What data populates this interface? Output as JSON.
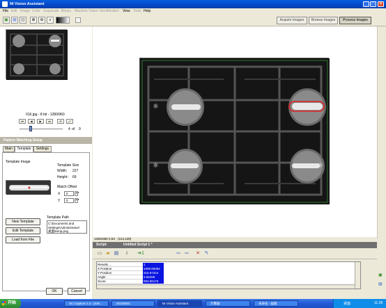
{
  "window": {
    "title": "NI Vision Assistant",
    "min": "_",
    "max": "□",
    "close": "×"
  },
  "menu": [
    {
      "label": "File",
      "enabled": true
    },
    {
      "label": "Edit",
      "enabled": false
    },
    {
      "label": "Image",
      "enabled": false
    },
    {
      "label": "Color",
      "enabled": false
    },
    {
      "label": "Grayscale",
      "enabled": false
    },
    {
      "label": "Binary",
      "enabled": false
    },
    {
      "label": "Machine Vision",
      "enabled": false
    },
    {
      "label": "Identification",
      "enabled": false
    },
    {
      "label": "View",
      "enabled": true
    },
    {
      "label": "Tools",
      "enabled": false
    },
    {
      "label": "Help",
      "enabled": true
    }
  ],
  "modes": [
    "Acquire Images",
    "Browse Images",
    "Process Images"
  ],
  "browser": {
    "file_info": "016.jpg - 8 bit - 1280/960",
    "position": "4",
    "of_label": "of",
    "total": "9",
    "nav": [
      "⏮",
      "◀",
      "▶",
      "⏭"
    ]
  },
  "setup": {
    "title": "Pattern Matching Setup",
    "tabs": [
      "Main",
      "Template",
      "Settings"
    ],
    "template_image_label": "Template Image",
    "template_size_label": "Template Size",
    "width_label": "Width:",
    "width": "227",
    "height_label": "Height:",
    "height": "69",
    "match_offset_label": "Match Offset",
    "x_label": "X",
    "x": "0",
    "y_label": "Y",
    "y": "0",
    "path_label": "Template Path",
    "path_lines": [
      "C:\\Documents and",
      "Settings\\Administrator\\",
      "桌面\\temp.png"
    ],
    "new_template": "New Template",
    "edit_template": "Edit Template",
    "load_from_file": "Load from File",
    "ok": "OK",
    "cancel": "Cancel"
  },
  "status": {
    "size": "1280x960 0.5X",
    "coords": "(214,139)"
  },
  "script": {
    "label": "Script:",
    "name": "Untitled Script 1 *"
  },
  "results": {
    "header": "Results ...",
    "rows": [
      {
        "label": "1",
        "value": "1"
      },
      {
        "label": "X Position",
        "value": "1099.68384"
      },
      {
        "label": "Y Position",
        "value": "315.97324"
      },
      {
        "label": "Angle",
        "value": "3.65288"
      },
      {
        "label": "Score",
        "value": "993.86176"
      }
    ]
  },
  "taskbar": {
    "start": "开始",
    "tasks": [
      "SC-Capture 2.3 - [SW...",
      "20100501",
      "NI Vision Assistant",
      "计算器",
      "未命名 - 画图"
    ],
    "tray_label": "桌面",
    "clock": "11:28"
  },
  "colors": {
    "titlebar": "#0a5ee0",
    "result_highlight": "#0a14e0",
    "match_box": "#e02020",
    "start_green": "#3fa946"
  }
}
